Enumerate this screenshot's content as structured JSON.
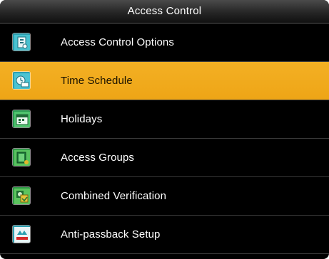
{
  "screen": {
    "title": "Access Control"
  },
  "menu": {
    "items": [
      {
        "label": "Access Control Options",
        "icon": "access-options-icon",
        "selected": false
      },
      {
        "label": "Time Schedule",
        "icon": "time-schedule-icon",
        "selected": true
      },
      {
        "label": "Holidays",
        "icon": "holidays-icon",
        "selected": false
      },
      {
        "label": "Access Groups",
        "icon": "access-groups-icon",
        "selected": false
      },
      {
        "label": "Combined Verification",
        "icon": "combined-verification-icon",
        "selected": false
      },
      {
        "label": "Anti-passback Setup",
        "icon": "anti-passback-icon",
        "selected": false
      }
    ]
  },
  "colors": {
    "selected_background": "#F0A81C",
    "background": "#000000",
    "text": "#FFFFFF"
  }
}
